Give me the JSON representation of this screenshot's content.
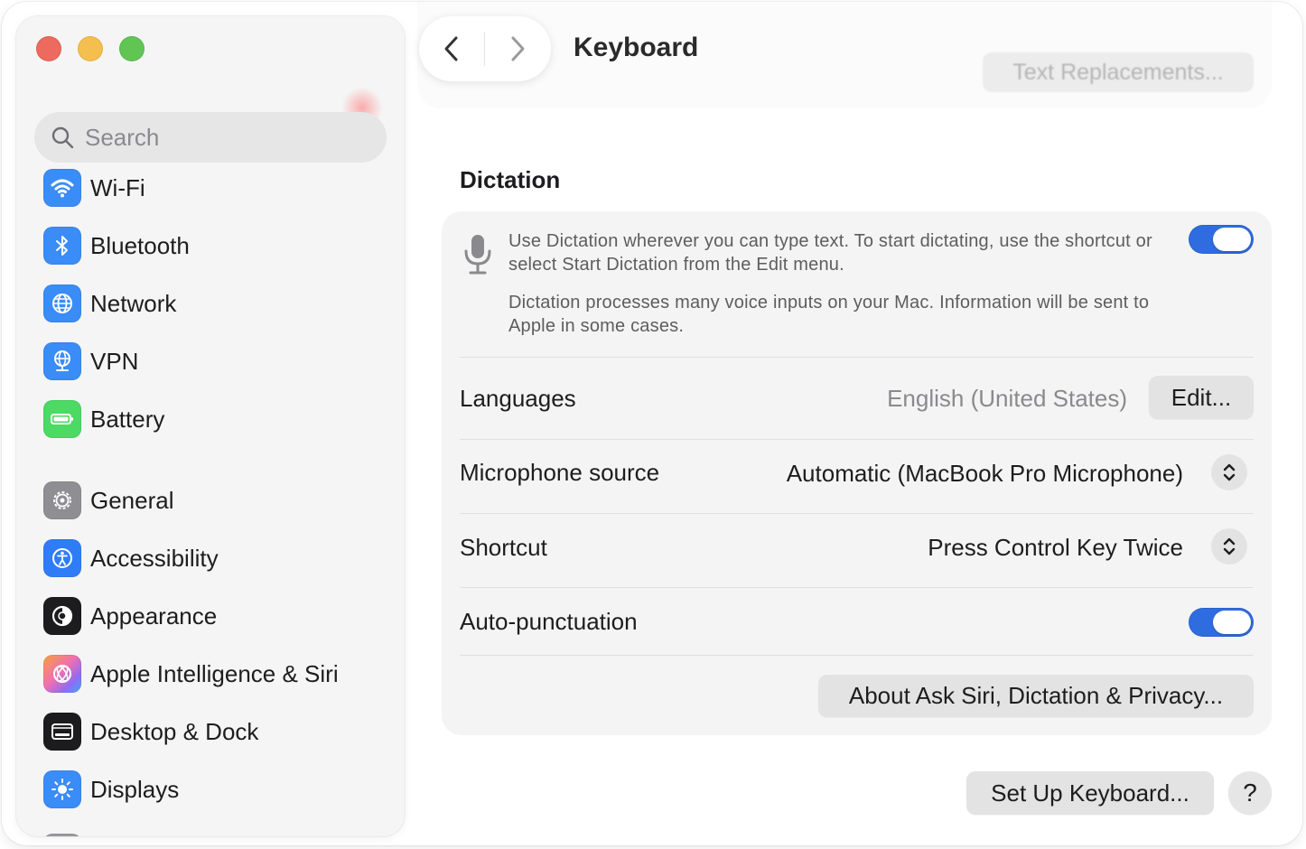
{
  "sidebar": {
    "search_placeholder": "Search",
    "items": [
      {
        "label": "Wi-Fi",
        "icon": "wifi-icon",
        "color": "#3a8cf7"
      },
      {
        "label": "Bluetooth",
        "icon": "bluetooth-icon",
        "color": "#3a8cf7"
      },
      {
        "label": "Network",
        "icon": "globe-icon",
        "color": "#3a8cf7"
      },
      {
        "label": "VPN",
        "icon": "vpn-globe-icon",
        "color": "#3a8cf7"
      },
      {
        "label": "Battery",
        "icon": "battery-icon",
        "color": "#4cd964"
      },
      {
        "label": "General",
        "icon": "gear-icon",
        "color": "#8e8e93"
      },
      {
        "label": "Accessibility",
        "icon": "accessibility-icon",
        "color": "#2f7df6"
      },
      {
        "label": "Appearance",
        "icon": "appearance-icon",
        "color": "#1c1c1e"
      },
      {
        "label": "Apple Intelligence & Siri",
        "icon": "siri-icon",
        "color": "#f06fb0"
      },
      {
        "label": "Desktop & Dock",
        "icon": "dock-icon",
        "color": "#1c1c1e"
      },
      {
        "label": "Displays",
        "icon": "sun-icon",
        "color": "#3a8cf7"
      }
    ]
  },
  "toolbar": {
    "title": "Keyboard",
    "text_replacements_label": "Text Replacements..."
  },
  "dictation": {
    "section_title": "Dictation",
    "description": "Use Dictation wherever you can type text. To start dictating, use the shortcut or select Start Dictation from the Edit menu.",
    "privacy_note": "Dictation processes many voice inputs on your Mac. Information will be sent to Apple in some cases.",
    "enabled": true,
    "languages_label": "Languages",
    "languages_value": "English (United States)",
    "edit_label": "Edit...",
    "mic_label": "Microphone source",
    "mic_value": "Automatic (MacBook Pro Microphone)",
    "shortcut_label": "Shortcut",
    "shortcut_value": "Press Control Key Twice",
    "autopunct_label": "Auto-punctuation",
    "autopunct_enabled": true,
    "about_label": "About Ask Siri, Dictation & Privacy..."
  },
  "footer": {
    "setup_keyboard_label": "Set Up Keyboard...",
    "help_label": "?"
  },
  "colors": {
    "accent": "#2f6cdf",
    "close": "#ed6a5e",
    "minimize": "#f5bf4f",
    "maximize": "#61c554"
  }
}
